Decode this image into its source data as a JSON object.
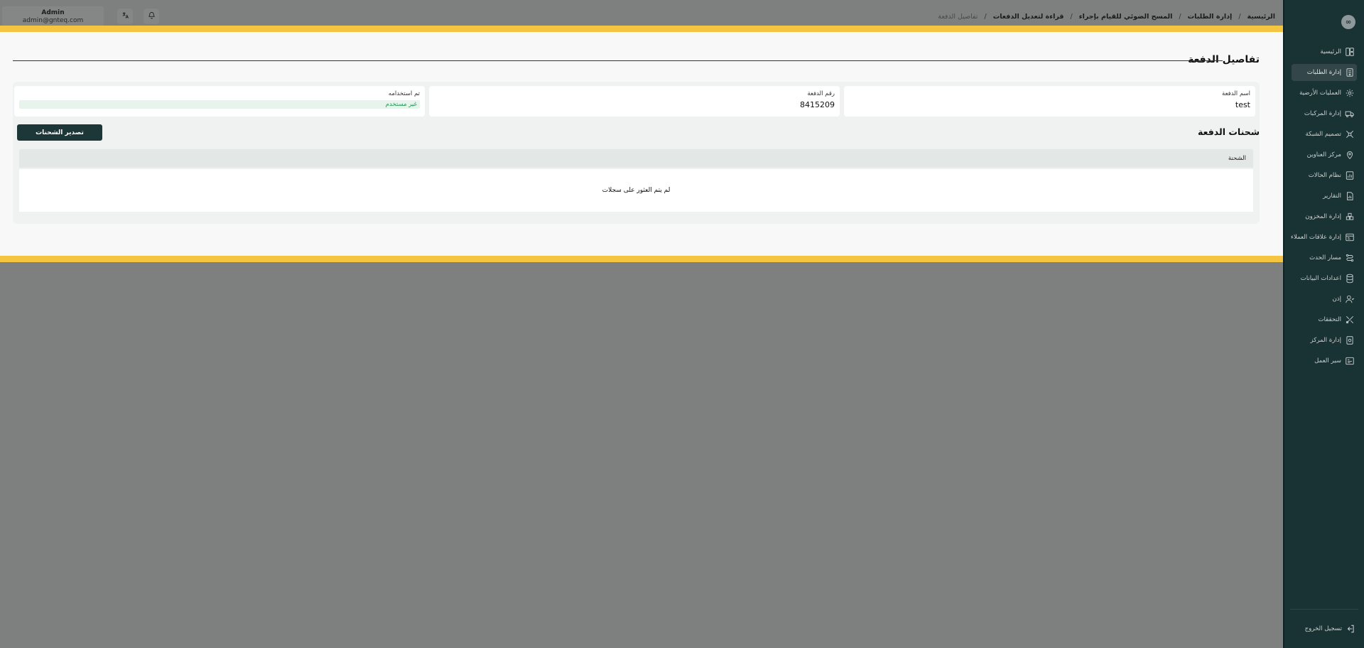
{
  "sidebar": {
    "logo_text": "∞",
    "items": [
      {
        "label": "الرئيسية",
        "icon": "home-icon"
      },
      {
        "label": "إدارة الطلبات",
        "icon": "orders-icon",
        "active": true
      },
      {
        "label": "العمليات الأرضية",
        "icon": "ground-ops-icon"
      },
      {
        "label": "إدارة المركبات",
        "icon": "truck-icon"
      },
      {
        "label": "تصميم الشبكة",
        "icon": "network-icon"
      },
      {
        "label": "مركز العناوين",
        "icon": "location-icon"
      },
      {
        "label": "نظام الحالات",
        "icon": "status-icon"
      },
      {
        "label": "التقارير",
        "icon": "reports-icon"
      },
      {
        "label": "إدارة المخزون",
        "icon": "inventory-icon"
      },
      {
        "label": "إدارة علاقات العملاء",
        "icon": "crm-icon"
      },
      {
        "label": "مسار الحدث",
        "icon": "route-icon"
      },
      {
        "label": "اعدادات البيانات",
        "icon": "database-icon"
      },
      {
        "label": "إذن",
        "icon": "permission-icon"
      },
      {
        "label": "التحققات",
        "icon": "validation-icon"
      },
      {
        "label": "إدارة المركز",
        "icon": "center-icon"
      },
      {
        "label": "سير العمل",
        "icon": "workflow-icon"
      }
    ],
    "logout_label": "تسجيل الخروج"
  },
  "header": {
    "breadcrumb": [
      {
        "label": "الرئيسية",
        "link": true
      },
      {
        "label": "إدارة الطلبات",
        "link": true
      },
      {
        "label": "المسح الضوئي للقيام بإجراء",
        "link": true
      },
      {
        "label": "قراءة لتعديل الدفعات",
        "link": true
      },
      {
        "label": "تفاصيل الدفعة",
        "link": false
      }
    ],
    "separator": "/",
    "user_name": "Admin",
    "user_email": "admin@gnteq.com"
  },
  "page": {
    "title": "تفاصيل الدفعة",
    "fields": {
      "batch_name_label": "اسم الدفعة",
      "batch_name_value": "test",
      "batch_number_label": "رقم الدفعة",
      "batch_number_value": "8415209",
      "used_label": "تم استخدامه",
      "used_value": "غير مستخدم"
    },
    "shipments_title": "شحنات الدفعة",
    "export_button": "تصدير الشحنات",
    "table_header": "الشحنة",
    "empty_message": "لم يتم العثور على سجلات"
  },
  "colors": {
    "sidebar_bg": "#193335",
    "highlight_border": "#f5c542",
    "primary_button": "#1d3739",
    "badge_text": "#1f9a57"
  }
}
